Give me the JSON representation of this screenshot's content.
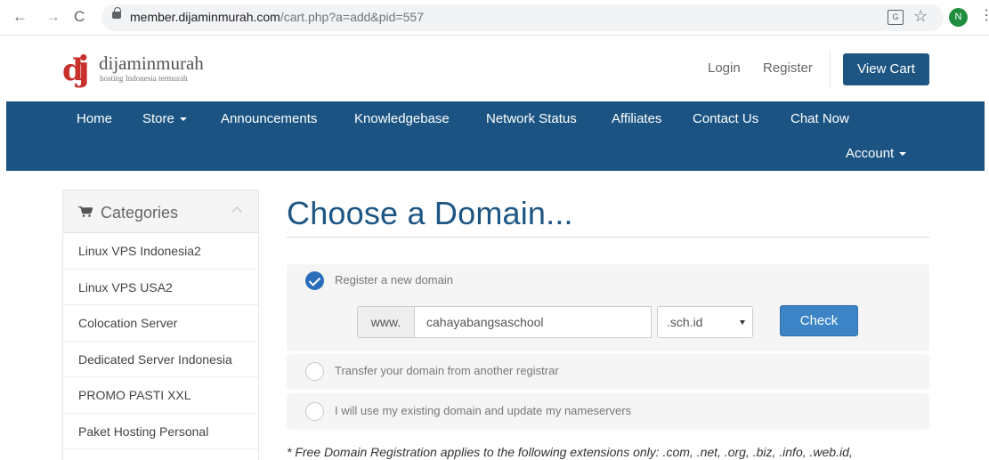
{
  "browser": {
    "back": "←",
    "forward": "→",
    "reload": "C",
    "url_host": "member.dijaminmurah.com",
    "url_path": "/cart.php?a=add&pid=557",
    "translate": "G",
    "star": "☆",
    "avatar": "N",
    "menu": "⋮"
  },
  "header": {
    "logo_name": "dijaminmurah",
    "logo_tagline": "hosting Indonesia termurah",
    "login": "Login",
    "register": "Register",
    "view_cart": "View Cart"
  },
  "nav": {
    "home": "Home",
    "store": "Store",
    "announcements": "Announcements",
    "knowledgebase": "Knowledgebase",
    "network_status": "Network Status",
    "affiliates": "Affiliates",
    "contact_us": "Contact Us",
    "chat_now": "Chat Now",
    "account": "Account"
  },
  "sidebar": {
    "title": "Categories",
    "items": [
      {
        "label": "Linux VPS Indonesia2"
      },
      {
        "label": "Linux VPS USA2"
      },
      {
        "label": "Colocation Server"
      },
      {
        "label": "Dedicated Server Indonesia"
      },
      {
        "label": "PROMO PASTI XXL"
      },
      {
        "label": "Paket Hosting Personal"
      }
    ]
  },
  "main": {
    "title": "Choose a Domain...",
    "options": [
      {
        "label": "Register a new domain",
        "checked": true
      },
      {
        "label": "Transfer your domain from another registrar",
        "checked": false
      },
      {
        "label": "I will use my existing domain and update my nameservers",
        "checked": false
      }
    ],
    "register": {
      "prefix": "www.",
      "domain_value": "cahayabangsaschool",
      "tld_selected": ".sch.id",
      "check_label": "Check"
    },
    "footnote": "* Free Domain Registration applies to the following extensions only: .com, .net, .org, .biz, .info, .web.id,"
  },
  "colors": {
    "brand_blue": "#1b5482",
    "button_blue": "#3c84c5",
    "logo_red": "#c8302b"
  }
}
